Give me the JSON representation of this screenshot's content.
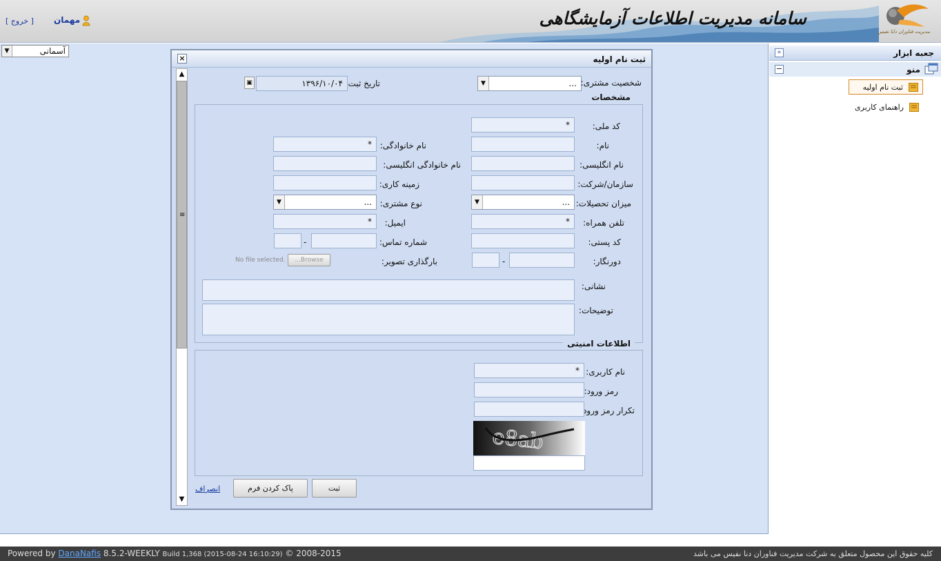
{
  "header": {
    "app_title": "سامانه مدیریت اطلاعات آزمایشگاهی",
    "logo_text": "مدیریت فناوران دانا نفیس",
    "logout_label": "[ خروج ]",
    "user_label": "مهمان"
  },
  "theme": {
    "selected": "آسمانی"
  },
  "sidebar": {
    "toolbox_title": "جعبه ابزار",
    "menu_title": "منو",
    "items": [
      {
        "label": "ثبت نام اولیه"
      },
      {
        "label": "راهنمای کاربری"
      }
    ]
  },
  "dialog": {
    "title": "ثبت نام اولیه",
    "customer_type_label": "شخصیت مشتری:",
    "customer_type_value": "...",
    "reg_date_label": "تاریخ ثبت:",
    "reg_date_value": "۱۳۹۶/۱۰/۰۴",
    "specs_legend": "مشخصات",
    "fields": {
      "national_code": {
        "label": "کد ملی:",
        "value": "*"
      },
      "first_name": {
        "label": "نام:",
        "value": ""
      },
      "last_name": {
        "label": "نام خانوادگی:",
        "value": "*"
      },
      "first_name_en": {
        "label": "نام انگلیسی:",
        "value": ""
      },
      "last_name_en": {
        "label": "نام خانوادگی انگلیسی:",
        "value": ""
      },
      "organization": {
        "label": "سازمان/شرکت:",
        "value": ""
      },
      "work_field": {
        "label": "زمینه کاری:",
        "value": ""
      },
      "education": {
        "label": "میزان تحصیلات:",
        "value": "..."
      },
      "customer_kind": {
        "label": "نوع مشتری:",
        "value": "..."
      },
      "mobile": {
        "label": "تلفن همراه:",
        "value": "*"
      },
      "email": {
        "label": "ایمیل:",
        "value": "*"
      },
      "postal_code": {
        "label": "کد پستی:",
        "value": ""
      },
      "phone": {
        "label": "شماره تماس:",
        "value": ""
      },
      "fax": {
        "label": "دورنگار:",
        "value": ""
      },
      "photo": {
        "label": "بارگذاری تصویر:",
        "button": "Browse...",
        "status": "No file selected."
      },
      "address": {
        "label": "نشانی:",
        "value": ""
      },
      "notes": {
        "label": "توضیحات:",
        "value": ""
      }
    },
    "dash": "-",
    "security_legend": "اطلاعات امنیتی",
    "security": {
      "username": {
        "label": "نام کاربری:",
        "value": "*"
      },
      "password": {
        "label": "رمز ورود:",
        "value": ""
      },
      "password_repeat": {
        "label": "تکرار رمز ورود:",
        "value": ""
      },
      "captcha_text": "e8ab"
    },
    "buttons": {
      "submit": "ثبت",
      "clear": "پاک کردن فرم",
      "cancel": "انصراف"
    }
  },
  "footer": {
    "powered_by": "Powered by",
    "brand": "DanaNafis",
    "version": "8.5.2-WEEKLY",
    "build": "Build 1,368 (2015-08-24 16:10:29)",
    "copyright": "© 2008-2015",
    "rights": "کلیه حقوق این محصول متعلق به شرکت مدیریت فناوران دنا نفیس می باشد"
  },
  "colors": {
    "main_bg": "#d6e2f5",
    "dialog_bg": "#cfdcf1",
    "input_bg": "#e8effa",
    "footer_bg": "#3d3d3d",
    "link": "#1a3aa0"
  }
}
